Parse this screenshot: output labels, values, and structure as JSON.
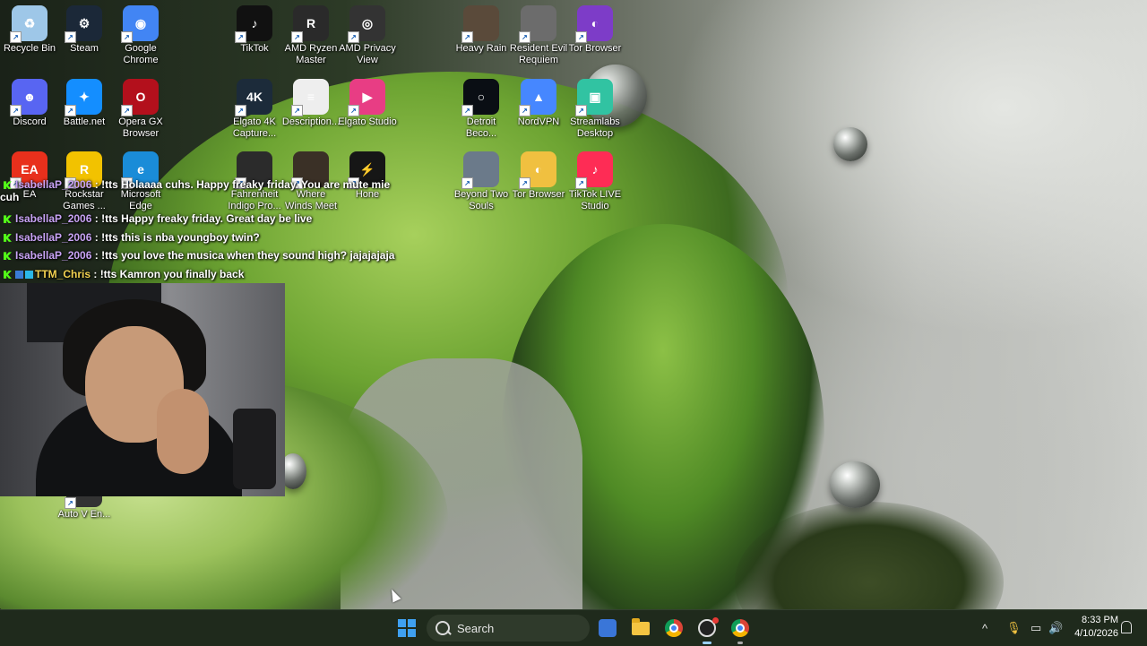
{
  "desktop": {
    "icons": [
      {
        "label": "Recycle Bin",
        "icon": "recycle-bin-icon",
        "color": "#9ec7e8",
        "glyph": "♻"
      },
      {
        "label": "Steam",
        "icon": "steam-icon",
        "color": "#1b2838",
        "glyph": "⚙"
      },
      {
        "label": "Google Chrome",
        "icon": "chrome-icon",
        "color": "#4285f4",
        "glyph": "◉"
      },
      {
        "label": "TikTok",
        "icon": "tiktok-icon",
        "color": "#111111",
        "glyph": "♪"
      },
      {
        "label": "AMD Ryzen Master",
        "icon": "ryzen-master-icon",
        "color": "#2a2a2a",
        "glyph": "R"
      },
      {
        "label": "AMD Privacy View",
        "icon": "privacy-view-icon",
        "color": "#333333",
        "glyph": "◎"
      },
      {
        "label": "Heavy Rain",
        "icon": "heavy-rain-icon",
        "color": "#5a4a3a",
        "glyph": ""
      },
      {
        "label": "Resident Evil Requiem",
        "icon": "resident-evil-icon",
        "color": "#6c6c6c",
        "glyph": ""
      },
      {
        "label": "Tor Browser",
        "icon": "tor-browser-icon",
        "color": "#7d3cc8",
        "glyph": "◐"
      },
      {
        "label": "Discord",
        "icon": "discord-icon",
        "color": "#5865f2",
        "glyph": "☻"
      },
      {
        "label": "Battle.net",
        "icon": "battlenet-icon",
        "color": "#148eff",
        "glyph": "✦"
      },
      {
        "label": "Opera GX Browser",
        "icon": "opera-gx-icon",
        "color": "#b3101c",
        "glyph": "O"
      },
      {
        "label": "Elgato 4K Capture...",
        "icon": "elgato-4k-icon",
        "color": "#1c2b3a",
        "glyph": "4K"
      },
      {
        "label": "Description...",
        "icon": "text-file-icon",
        "color": "#eeeeee",
        "glyph": "≡"
      },
      {
        "label": "Elgato Studio",
        "icon": "elgato-studio-icon",
        "color": "#e83d84",
        "glyph": "▶"
      },
      {
        "label": "Detroit Beco...",
        "icon": "detroit-become-human-icon",
        "color": "#0a0e14",
        "glyph": "○"
      },
      {
        "label": "NordVPN",
        "icon": "nordvpn-icon",
        "color": "#4687ff",
        "glyph": "▲"
      },
      {
        "label": "Streamlabs Desktop",
        "icon": "streamlabs-icon",
        "color": "#31c3a2",
        "glyph": "▣"
      },
      {
        "label": "EA",
        "icon": "ea-icon",
        "color": "#e8301c",
        "glyph": "EA"
      },
      {
        "label": "Rockstar Games ...",
        "icon": "rockstar-icon",
        "color": "#f2c200",
        "glyph": "R"
      },
      {
        "label": "Microsoft Edge",
        "icon": "edge-icon",
        "color": "#1a8cd8",
        "glyph": "e"
      },
      {
        "label": "Fahrenheit Indigo Pro...",
        "icon": "fahrenheit-icon",
        "color": "#2b2b2b",
        "glyph": ""
      },
      {
        "label": "Where Winds Meet",
        "icon": "where-winds-meet-icon",
        "color": "#3a3026",
        "glyph": ""
      },
      {
        "label": "Hone",
        "icon": "hone-icon",
        "color": "#161616",
        "glyph": "⚡"
      },
      {
        "label": "Beyond Two Souls",
        "icon": "beyond-two-souls-icon",
        "color": "#6b7a8a",
        "glyph": ""
      },
      {
        "label": "Tor Browser",
        "icon": "tor-browser-folder-icon",
        "color": "#f0c040",
        "glyph": "◐"
      },
      {
        "label": "TikTok LIVE Studio",
        "icon": "tiktok-live-studio-icon",
        "color": "#fe2c55",
        "glyph": "♪"
      },
      {
        "label": "Auto V En...",
        "icon": "autov-icon",
        "color": "#333333",
        "glyph": ""
      }
    ]
  },
  "chat": {
    "messages": [
      {
        "user": "IsabellaP_2006",
        "sep": " : ",
        "text": "!tts Holaaaa cuhs. Happy freaky friday. You are mute mie",
        "wrap": "cuh"
      },
      {
        "user": "IsabellaP_2006",
        "sep": " : ",
        "text": "!tts Happy freaky friday. Great day be live",
        "wrap": ""
      },
      {
        "user": "IsabellaP_2006",
        "sep": " : ",
        "text": "!tts this is nba youngboy twin?",
        "wrap": ""
      },
      {
        "user": "IsabellaP_2006",
        "sep": " : ",
        "text": "!tts you love the musica when they sound high? jajajajaja",
        "wrap": ""
      },
      {
        "user": "TTM_Chris",
        "sep": " : ",
        "text": "!tts Kamron you finally back",
        "wrap": ""
      }
    ]
  },
  "taskbar": {
    "search_label": "Search",
    "apps": [
      "windows-start-icon",
      "search-icon",
      "microsoft-store-icon",
      "file-explorer-icon",
      "chrome-icon",
      "obs-icon",
      "chrome-profile-icon"
    ],
    "tray_up": "^",
    "tray_mic": "🎙",
    "tray_net": "▭",
    "tray_vol": "🔊",
    "time": "8:33 PM",
    "date": "4/10/2026"
  },
  "colors": {
    "start_accent": "#3fa0f0",
    "chat_user": "#c8a3f5",
    "chat_user_alt": "#f0d050",
    "kick_green": "#53fc18"
  }
}
